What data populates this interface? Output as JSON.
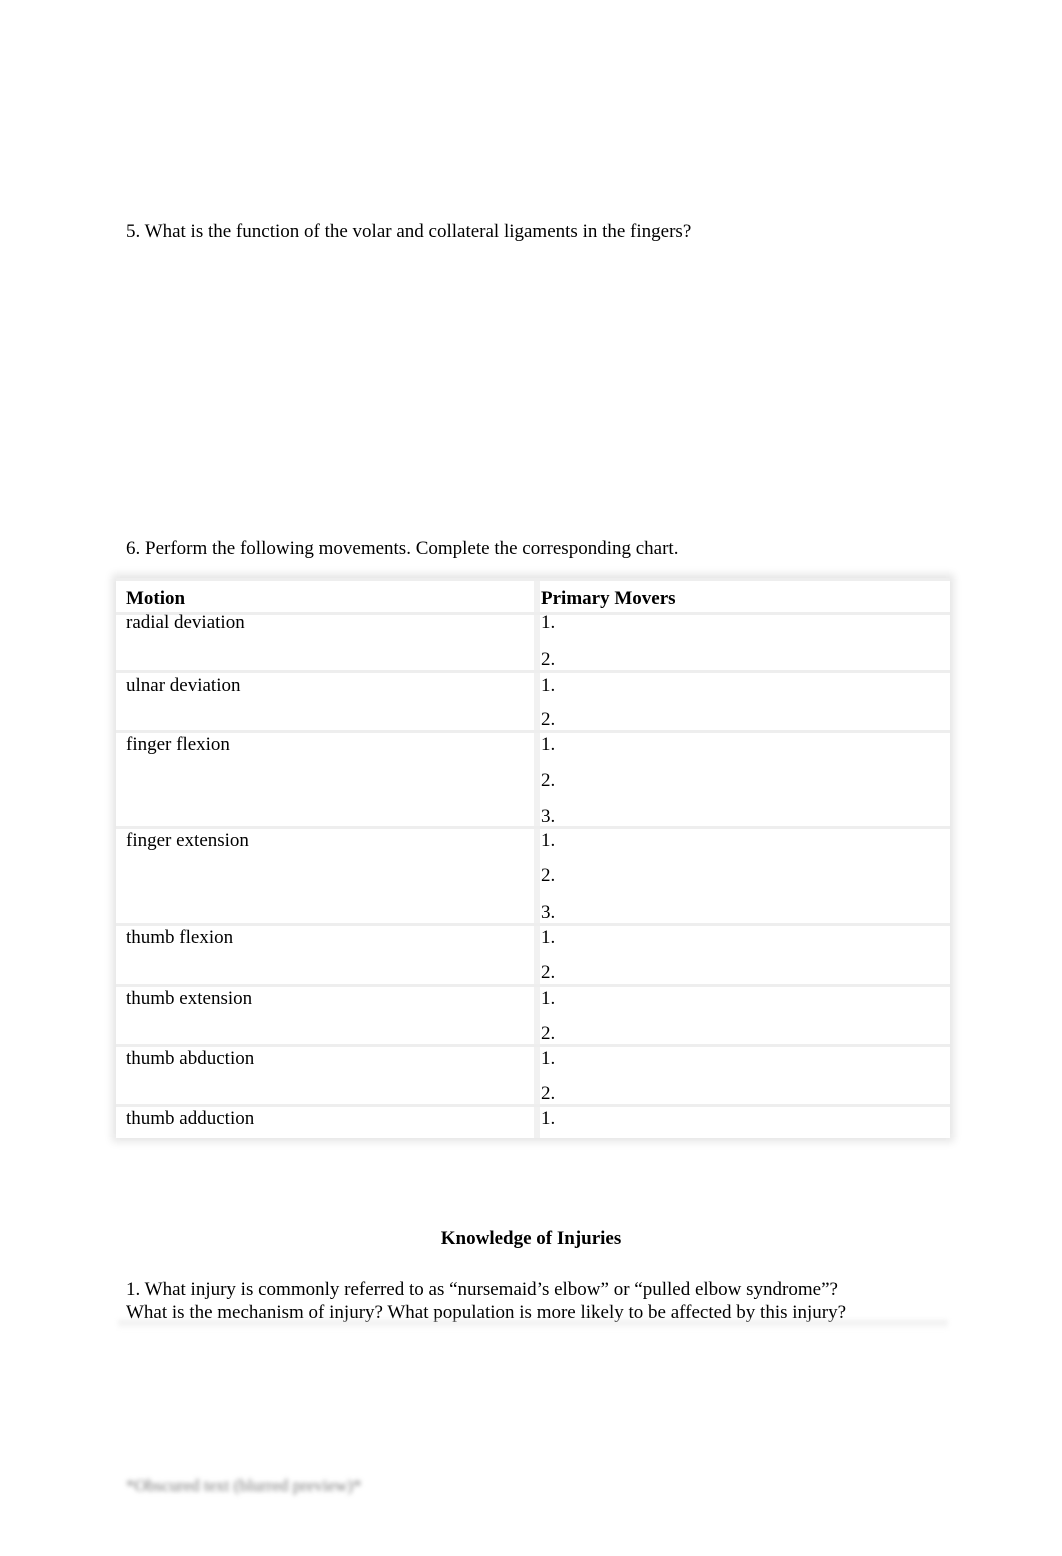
{
  "questions": {
    "q5": "5. What is the function of the volar and collateral ligaments in the fingers?",
    "q6": "6. Perform the following movements. Complete the corresponding chart."
  },
  "chart": {
    "headers": {
      "motion": "Motion",
      "movers": "Primary Movers"
    },
    "rows": [
      {
        "motion": "radial deviation",
        "movers": [
          "1.",
          "2."
        ]
      },
      {
        "motion": "ulnar deviation",
        "movers": [
          "1.",
          "2."
        ]
      },
      {
        "motion": "finger flexion",
        "movers": [
          "1.",
          "2.",
          "3."
        ]
      },
      {
        "motion": "finger extension",
        "movers": [
          "1.",
          "2.",
          "3."
        ]
      },
      {
        "motion": "thumb flexion",
        "movers": [
          "1.",
          "2."
        ]
      },
      {
        "motion": "thumb extension",
        "movers": [
          "1.",
          "2."
        ]
      },
      {
        "motion": "thumb abduction",
        "movers": [
          "1.",
          "2."
        ]
      },
      {
        "motion": "thumb adduction",
        "movers": [
          "1."
        ]
      }
    ]
  },
  "injuries": {
    "title": "Knowledge of Injuries",
    "q1_line1": "1. What injury is commonly referred to as “nursemaid’s elbow” or “pulled elbow syndrome”?",
    "q1_line2": "What is the mechanism of injury? What population is more likely to be affected by this injury?",
    "blurred_line": "*Obscured text (blurred preview)*"
  }
}
